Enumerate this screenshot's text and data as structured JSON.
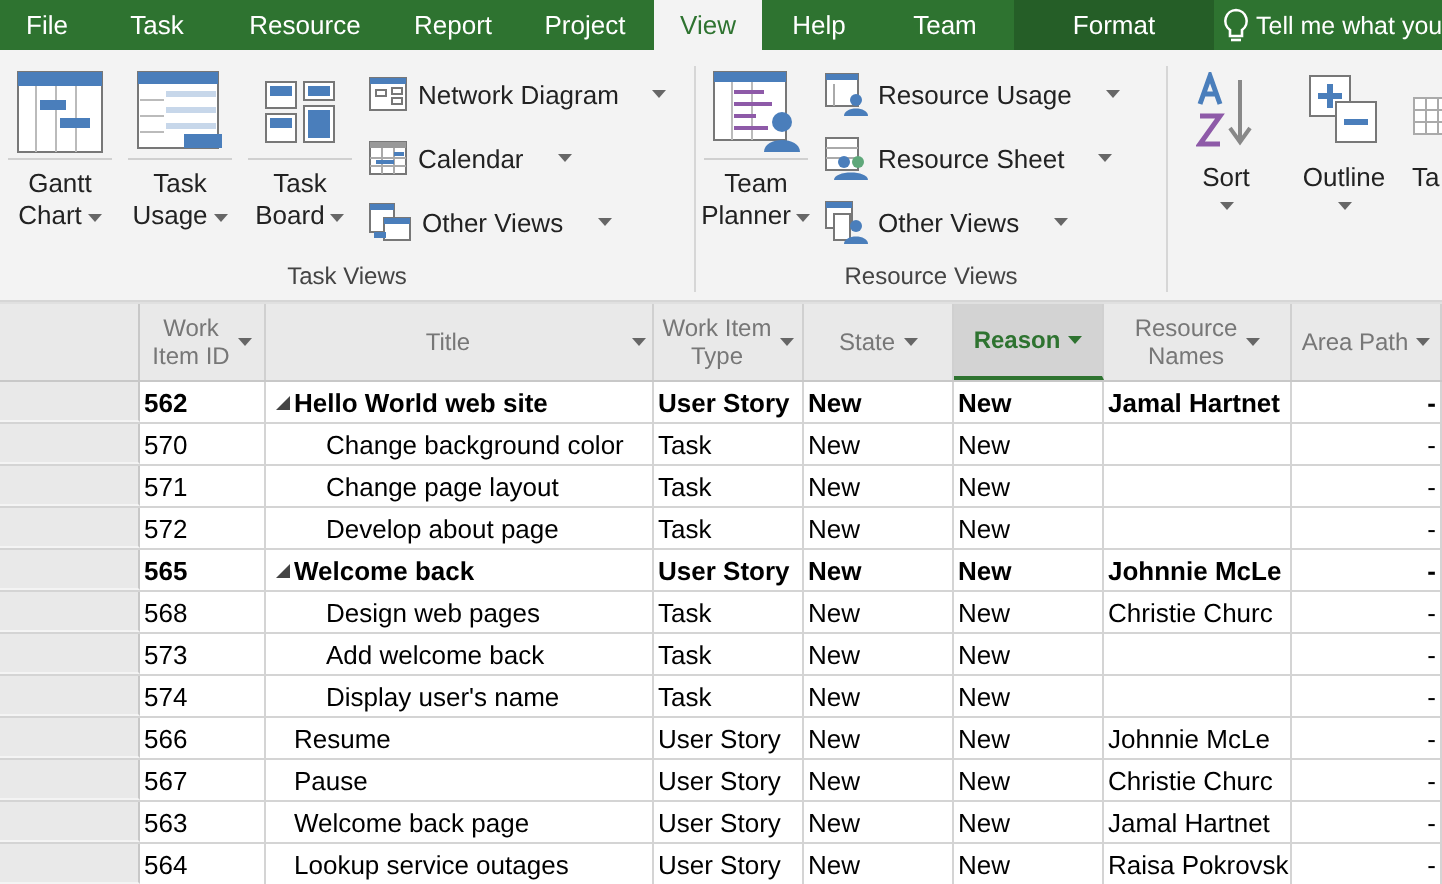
{
  "tabs": [
    {
      "label": "File",
      "selected": false,
      "kind": "tab"
    },
    {
      "label": "Task",
      "selected": false,
      "kind": "tab"
    },
    {
      "label": "Resource",
      "selected": false,
      "kind": "tab"
    },
    {
      "label": "Report",
      "selected": false,
      "kind": "tab"
    },
    {
      "label": "Project",
      "selected": false,
      "kind": "tab"
    },
    {
      "label": "View",
      "selected": true,
      "kind": "tab"
    },
    {
      "label": "Help",
      "selected": false,
      "kind": "tab"
    },
    {
      "label": "Team",
      "selected": false,
      "kind": "tab"
    },
    {
      "label": "Format",
      "selected": false,
      "kind": "contextual"
    },
    {
      "label": "Tell me what you",
      "selected": false,
      "kind": "search"
    }
  ],
  "ribbon": {
    "groups": [
      {
        "label": "Task Views",
        "big_buttons": [
          {
            "label": "Gantt\nChart",
            "kind": "gantt",
            "dropdown": true
          },
          {
            "label": "Task\nUsage",
            "kind": "usage",
            "dropdown": true
          },
          {
            "label": "Task\nBoard",
            "kind": "board",
            "dropdown": true
          }
        ],
        "small_buttons": [
          {
            "label": "Network Diagram",
            "kind": "network",
            "dropdown": true
          },
          {
            "label": "Calendar",
            "kind": "calendar",
            "dropdown": true
          },
          {
            "label": "Other Views",
            "kind": "other",
            "dropdown": true
          }
        ]
      },
      {
        "label": "Resource Views",
        "big_buttons": [
          {
            "label": "Team\nPlanner",
            "kind": "planner",
            "dropdown": true
          }
        ],
        "small_buttons": [
          {
            "label": "Resource Usage",
            "kind": "resusage",
            "dropdown": true
          },
          {
            "label": "Resource Sheet",
            "kind": "ressheet",
            "dropdown": true
          },
          {
            "label": "Other Views",
            "kind": "resother",
            "dropdown": true
          }
        ]
      },
      {
        "big_buttons": [
          {
            "label": "Sort",
            "kind": "sort",
            "dropdown": true
          },
          {
            "label": "Outline",
            "kind": "outline",
            "dropdown": true
          },
          {
            "label": "Ta",
            "kind": "table",
            "dropdown": false
          }
        ]
      }
    ]
  },
  "table": {
    "columns": [
      {
        "label": "Work\nItem ID",
        "selected": false
      },
      {
        "label": "Title",
        "selected": false
      },
      {
        "label": "Work Item\nType",
        "selected": false
      },
      {
        "label": "State",
        "selected": false
      },
      {
        "label": "Reason",
        "selected": true
      },
      {
        "label": "Resource\nNames",
        "selected": false
      },
      {
        "label": "Area Path",
        "selected": false
      }
    ],
    "rows": [
      {
        "id": "562",
        "title": "Hello World web site",
        "type": "User Story",
        "state": "New",
        "reason": "New",
        "resource": "Jamal Hartnet",
        "area": "-",
        "summary": true,
        "expanded": true,
        "children": [
          {
            "id": "570",
            "title": "Change background color",
            "type": "Task",
            "state": "New",
            "reason": "New",
            "area": "-",
            "summary": false
          },
          {
            "id": "571",
            "title": "Change page layout",
            "type": "Task",
            "state": "New",
            "reason": "New",
            "area": "-",
            "summary": false
          },
          {
            "id": "572",
            "title": "Develop about page",
            "type": "Task",
            "state": "New",
            "reason": "New",
            "area": "-",
            "summary": false
          }
        ]
      },
      {
        "id": "565",
        "title": "Welcome back",
        "type": "User Story",
        "state": "New",
        "reason": "New",
        "resource": "Johnnie McLe",
        "area": "-",
        "summary": true,
        "expanded": true,
        "children": [
          {
            "id": "568",
            "title": "Design web pages",
            "type": "Task",
            "state": "New",
            "reason": "New",
            "resource": "Christie Churc",
            "area": "-",
            "summary": false
          },
          {
            "id": "573",
            "title": "Add welcome back",
            "type": "Task",
            "state": "New",
            "reason": "New",
            "area": "-",
            "summary": false
          },
          {
            "id": "574",
            "title": "Display user's name",
            "type": "Task",
            "state": "New",
            "reason": "New",
            "area": "-",
            "summary": false
          }
        ]
      },
      {
        "id": "566",
        "title": "Resume",
        "type": "User Story",
        "state": "New",
        "reason": "New",
        "resource": "Johnnie McLe",
        "area": "-",
        "summary": false
      },
      {
        "id": "567",
        "title": "Pause",
        "type": "User Story",
        "state": "New",
        "reason": "New",
        "resource": "Christie Churc",
        "area": "-",
        "summary": false
      },
      {
        "id": "563",
        "title": "Welcome back page",
        "type": "User Story",
        "state": "New",
        "reason": "New",
        "resource": "Jamal Hartnet",
        "area": "-",
        "summary": false
      },
      {
        "id": "564",
        "title": "Lookup service outages",
        "type": "User Story",
        "state": "New",
        "reason": "New",
        "resource": "Raisa Pokrovsk",
        "area": "-",
        "summary": false
      }
    ]
  }
}
